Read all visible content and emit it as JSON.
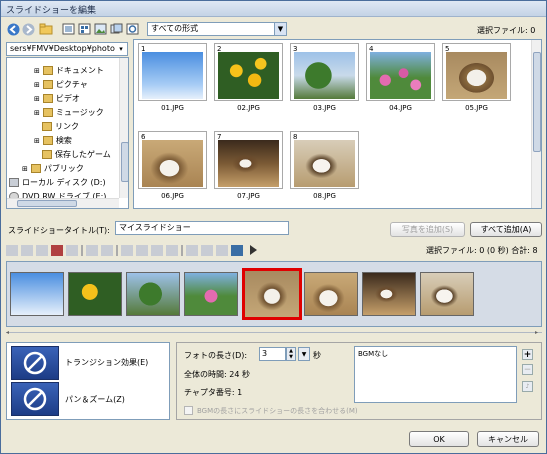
{
  "window": {
    "title": "スライドショーを編集"
  },
  "toolbar": {
    "format_value": "すべての形式",
    "selected_files_label": "選択ファイル: 0"
  },
  "path": {
    "value": "sers¥FMV¥Desktop¥photo¥"
  },
  "tree": {
    "items": [
      {
        "label": "ドキュメント"
      },
      {
        "label": "ピクチャ"
      },
      {
        "label": "ビデオ"
      },
      {
        "label": "ミュージック"
      },
      {
        "label": "リンク"
      },
      {
        "label": "検索"
      },
      {
        "label": "保存したゲーム"
      },
      {
        "label": "パブリック"
      },
      {
        "label": "ローカル ディスク (D:)"
      },
      {
        "label": "DVD RW ドライブ (E:)"
      }
    ]
  },
  "grid": {
    "items": [
      {
        "num": "1",
        "name": "01.JPG"
      },
      {
        "num": "2",
        "name": "02.JPG"
      },
      {
        "num": "3",
        "name": "03.JPG"
      },
      {
        "num": "4",
        "name": "04.JPG"
      },
      {
        "num": "5",
        "name": "05.JPG"
      },
      {
        "num": "6",
        "name": "06.JPG"
      },
      {
        "num": "7",
        "name": "07.JPG"
      },
      {
        "num": "8",
        "name": "08.JPG"
      }
    ]
  },
  "slideshow": {
    "title_label": "スライドショータイトル(T):",
    "title_value": "マイスライドショー",
    "add_selected_label": "写真を追加(S)",
    "add_all_label": "すべて追加(A)",
    "status": "選択ファイル: 0 (0 秒)  合計: 8"
  },
  "effects": {
    "transition_label": "トランジション効果(E)",
    "panzoom_label": "パン＆ズーム(Z)"
  },
  "settings": {
    "photo_length_label": "フォトの長さ(D):",
    "photo_length_value": "3",
    "seconds_unit": "秒",
    "total_time": "全体の時間: 24 秒",
    "chapter_number": "チャプタ番号: 1",
    "bgm_value": "BGMなし",
    "fit_bgm_label": "BGMの長さにスライドショーの長さを合わせる(M)"
  },
  "footer": {
    "ok_label": "OK",
    "cancel_label": "キャンセル"
  }
}
